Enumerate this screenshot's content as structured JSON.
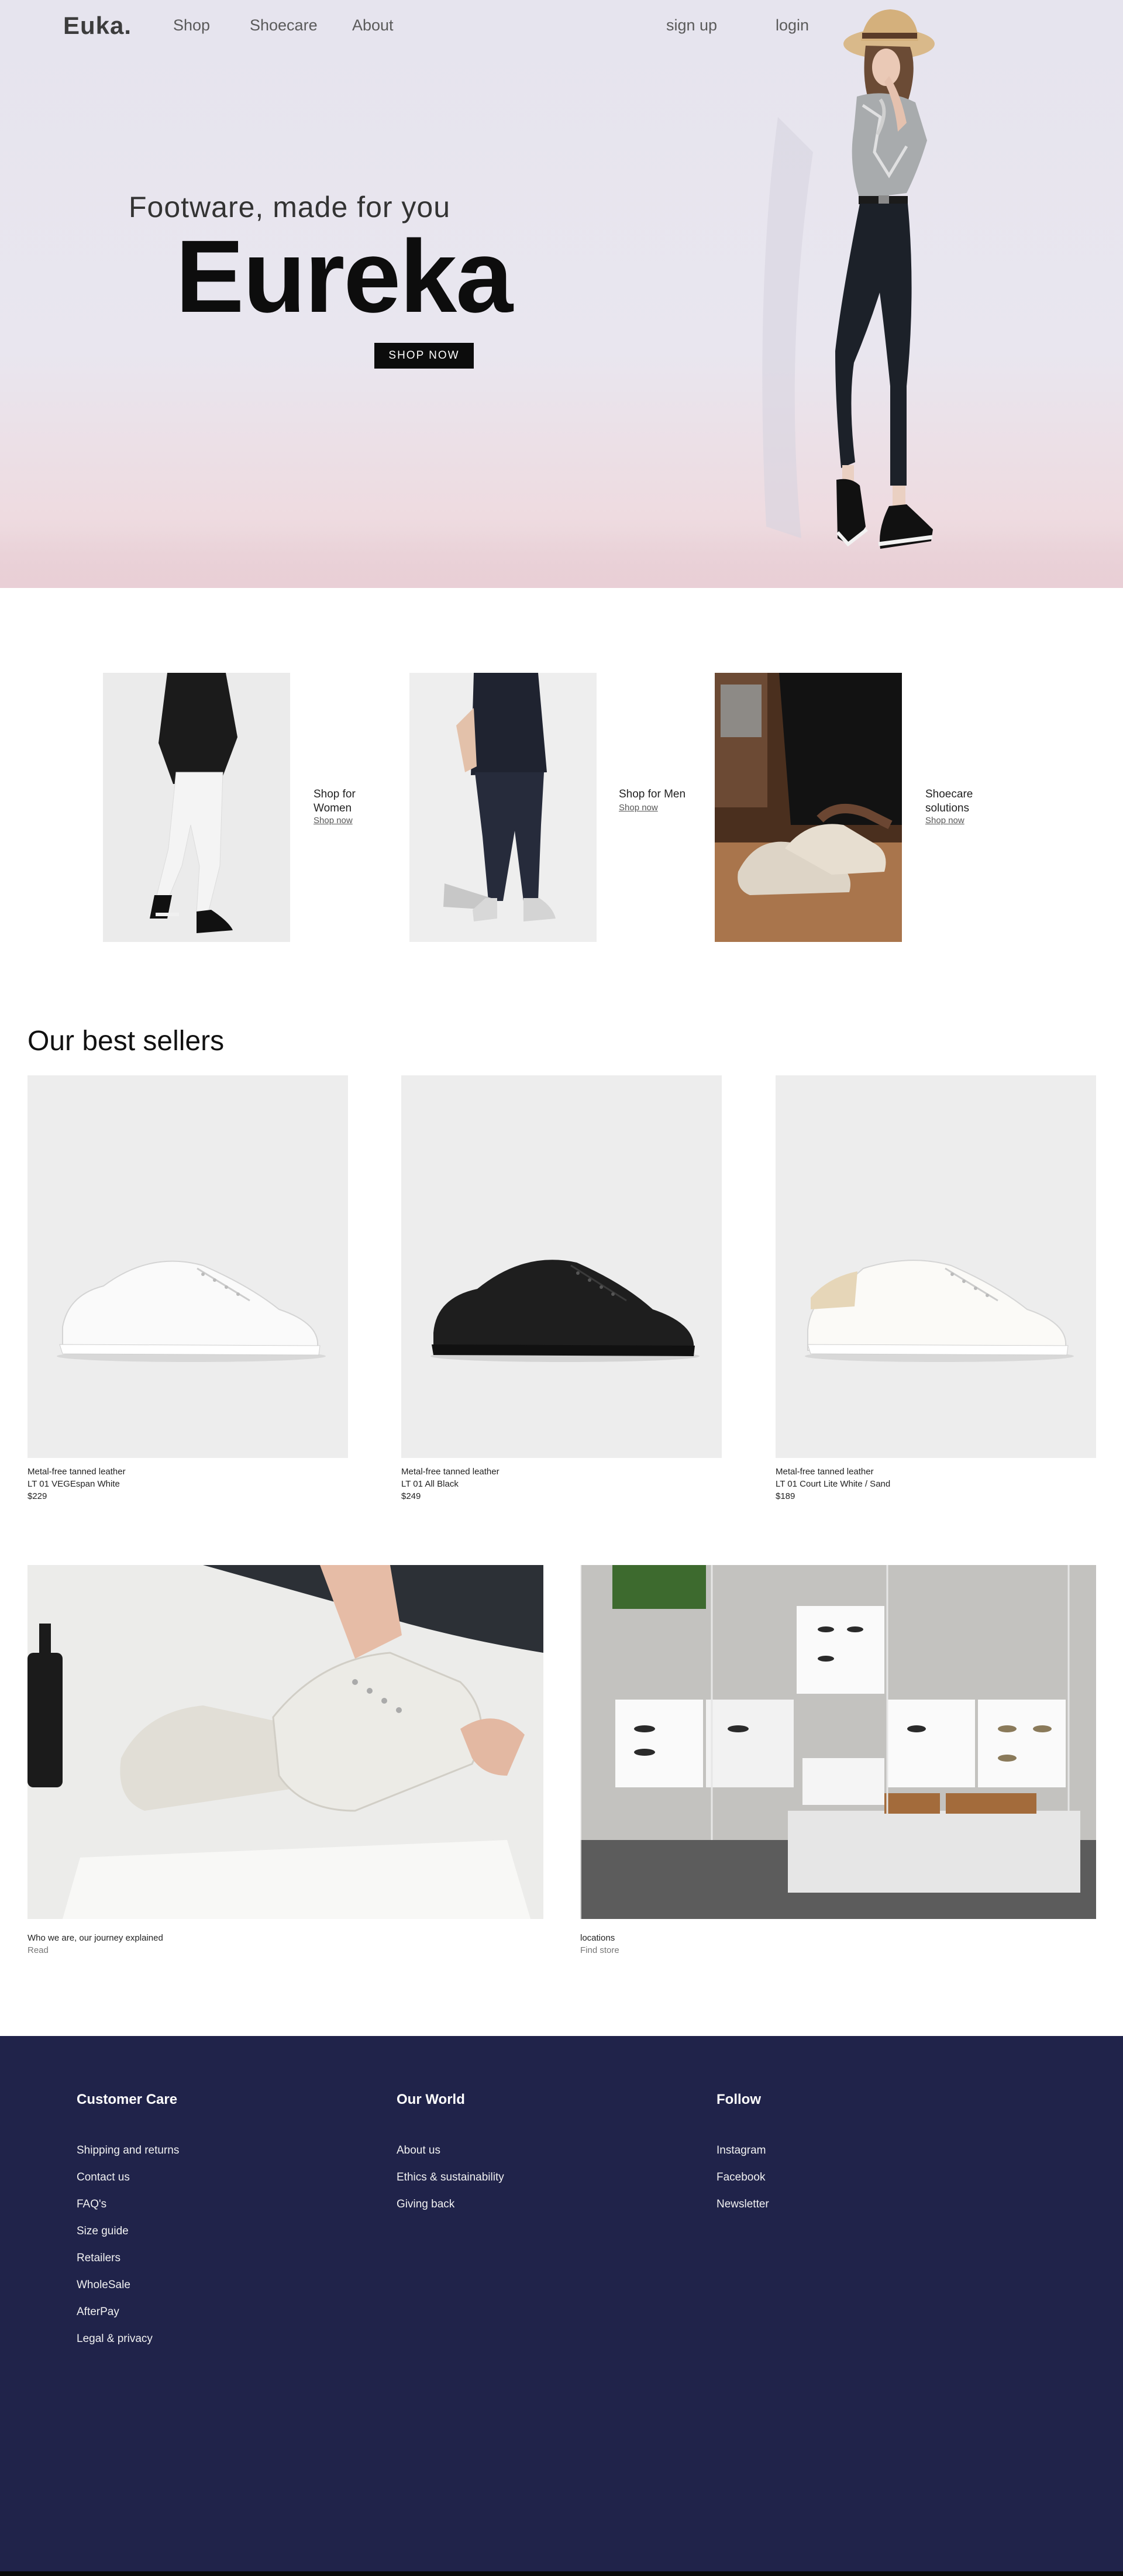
{
  "nav": {
    "logo": "Euka.",
    "links": [
      "Shop",
      "Shoecare",
      "About"
    ],
    "signup": "sign up",
    "login": "login"
  },
  "hero": {
    "tagline": "Footware, made for you",
    "title": "Eureka",
    "cta": "SHOP NOW"
  },
  "categories": [
    {
      "label_line1": "Shop for",
      "label_line2": "Women",
      "link": "Shop now"
    },
    {
      "label_line1": "Shop for Men",
      "label_line2": "",
      "link": "Shop now"
    },
    {
      "label_line1": "Shoecare",
      "label_line2": "solutions",
      "link": "Shop now"
    }
  ],
  "best_sellers": {
    "title": "Our best sellers",
    "products": [
      {
        "material": "Metal-free tanned leather",
        "name": "LT 01 VEGEspan White",
        "price": "$229"
      },
      {
        "material": "Metal-free tanned leather",
        "name": "LT 01 All Black",
        "price": "$249"
      },
      {
        "material": "Metal-free tanned leather",
        "name": "LT 01 Court Lite White / Sand",
        "price": "$189"
      }
    ]
  },
  "story": [
    {
      "caption": "Who we are, our journey explained",
      "link": "Read"
    },
    {
      "caption": "locations",
      "link": "Find store"
    }
  ],
  "footer": {
    "columns": [
      {
        "title": "Customer Care",
        "links": [
          "Shipping and returns",
          "Contact us",
          "FAQ's",
          "Size guide",
          "Retailers",
          "WholeSale",
          "AfterPay",
          "Legal & privacy"
        ]
      },
      {
        "title": "Our World",
        "links": [
          "About us",
          "Ethics & sustainability",
          "Giving back"
        ]
      },
      {
        "title": "Follow",
        "links": [
          "Instagram",
          "Facebook",
          "Newsletter"
        ]
      }
    ]
  },
  "colors": {
    "footer_bg": "#20234a",
    "button_bg": "#0c0c0c",
    "product_bg": "#ededed"
  }
}
